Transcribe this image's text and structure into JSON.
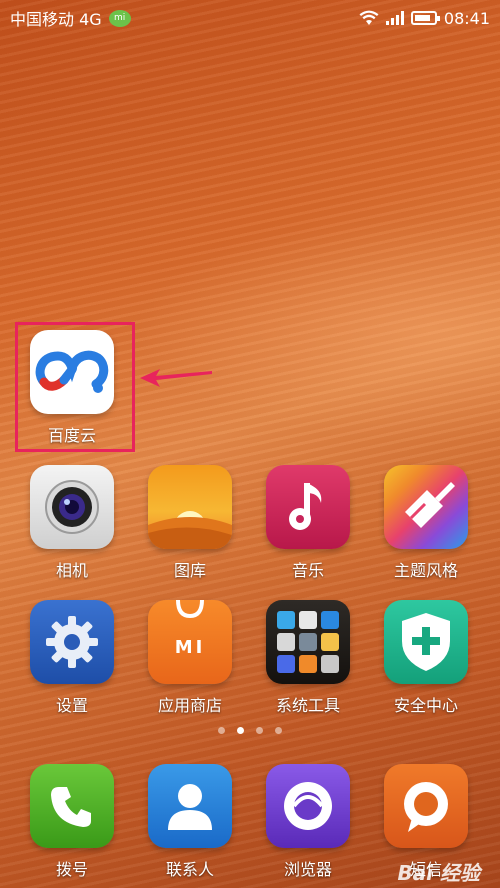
{
  "status_bar": {
    "carrier": "中国移动 4G",
    "mi_badge": "mi",
    "time": "08:41",
    "battery_level": 0.85
  },
  "highlighted_app": {
    "label": "百度云"
  },
  "apps": [
    {
      "label": "相机"
    },
    {
      "label": "图库"
    },
    {
      "label": "音乐"
    },
    {
      "label": "主题风格"
    },
    {
      "label": "设置"
    },
    {
      "label": "应用商店"
    },
    {
      "label": "系统工具"
    },
    {
      "label": "安全中心"
    }
  ],
  "page_indicator": {
    "count": 4,
    "active": 1
  },
  "dock": [
    {
      "label": "拨号"
    },
    {
      "label": "联系人"
    },
    {
      "label": "浏览器"
    },
    {
      "label": "短信"
    }
  ],
  "store_icon_text": "MI",
  "watermark": "Bai 经验",
  "colors": {
    "highlight": "#e8245c",
    "wallpaper": "#d86a2c"
  }
}
